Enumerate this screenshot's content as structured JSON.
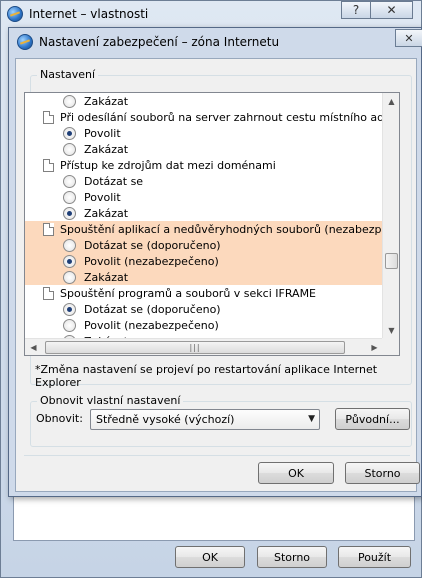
{
  "outer_window": {
    "title": "Internet – vlastnosti",
    "help_button": "?",
    "close_button": "✕",
    "buttons": {
      "ok": "OK",
      "cancel": "Storno",
      "apply": "Použít"
    }
  },
  "dialog": {
    "title": "Nastavení zabezpečení – zóna Internetu",
    "close_button": "✕",
    "settings_group_label": "Nastavení",
    "settings_rows": [
      {
        "type": "option",
        "label": "Zakázat",
        "selected": false
      },
      {
        "type": "heading",
        "label": "Při odesílání souborů na server zahrnout cestu místního adresáře"
      },
      {
        "type": "option",
        "label": "Povolit",
        "selected": true
      },
      {
        "type": "option",
        "label": "Zakázat",
        "selected": false
      },
      {
        "type": "heading",
        "label": "Přístup ke zdrojům dat mezi doménami"
      },
      {
        "type": "option",
        "label": "Dotázat se",
        "selected": false
      },
      {
        "type": "option",
        "label": "Povolit",
        "selected": false
      },
      {
        "type": "option",
        "label": "Zakázat",
        "selected": true
      },
      {
        "type": "heading",
        "label": "Spouštění aplikací a nedůvěryhodných souborů (nezabezpečeno)",
        "highlight": true
      },
      {
        "type": "option",
        "label": "Dotázat se (doporučeno)",
        "selected": false,
        "highlight": true
      },
      {
        "type": "option",
        "label": "Povolit (nezabezpečeno)",
        "selected": true,
        "highlight": true
      },
      {
        "type": "option",
        "label": "Zakázat",
        "selected": false,
        "highlight": true
      },
      {
        "type": "heading",
        "label": "Spouštění programů a souborů v sekci IFRAME"
      },
      {
        "type": "option",
        "label": "Dotázat se (doporučeno)",
        "selected": true
      },
      {
        "type": "option",
        "label": "Povolit (nezabezpečeno)",
        "selected": false
      },
      {
        "type": "option",
        "label": "Zakázat",
        "selected": false
      }
    ],
    "restart_note": "*Změna nastavení se projeví po restartování aplikace Internet Explorer",
    "reset_group_label": "Obnovit vlastní nastavení",
    "reset_label": "Obnovit:",
    "reset_selected": "Středně vysoké (výchozí)",
    "reset_button": "Původní...",
    "ok_button": "OK",
    "cancel_button": "Storno",
    "scrollbar_glyphs": {
      "up": "▲",
      "down": "▼",
      "left": "◀",
      "right": "▶",
      "grip": "|||"
    }
  },
  "colors": {
    "highlight_row": "#fcd9bd",
    "dialog_frame": "#cfdaea"
  }
}
